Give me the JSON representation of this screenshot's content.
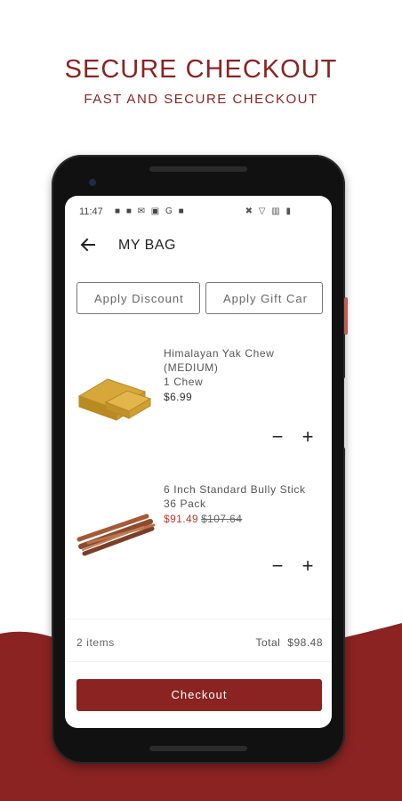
{
  "promo": {
    "title": "SECURE CHECKOUT",
    "subtitle": "FAST AND SECURE CHECKOUT"
  },
  "colors": {
    "brand": "#8a2322",
    "sale": "#c0392b"
  },
  "status_bar": {
    "time": "11:47",
    "left_icons": "■ ■ ✉ ▣ G ■",
    "right_icons": "✖ ▽ ▥ ▮"
  },
  "header": {
    "title": "MY BAG",
    "back_icon": "arrow-left-icon"
  },
  "codes": {
    "discount_label": "Apply Discount",
    "gift_label": "Apply Gift Car"
  },
  "items": [
    {
      "name_line1": "Himalayan Yak Chew",
      "name_line2": "(MEDIUM)",
      "variant": "1 Chew",
      "price": "$6.99",
      "image": "yak-chew-image"
    },
    {
      "name_line1": "6 Inch Standard Bully Stick",
      "variant": "36 Pack",
      "sale_price": "$91.49",
      "original_price": "$107.64",
      "image": "bully-stick-image"
    }
  ],
  "qty": {
    "minus": "−",
    "plus": "+"
  },
  "footer": {
    "items_count": "2 items",
    "total_label": "Total",
    "total_value": "$98.48",
    "checkout_label": "Checkout"
  }
}
